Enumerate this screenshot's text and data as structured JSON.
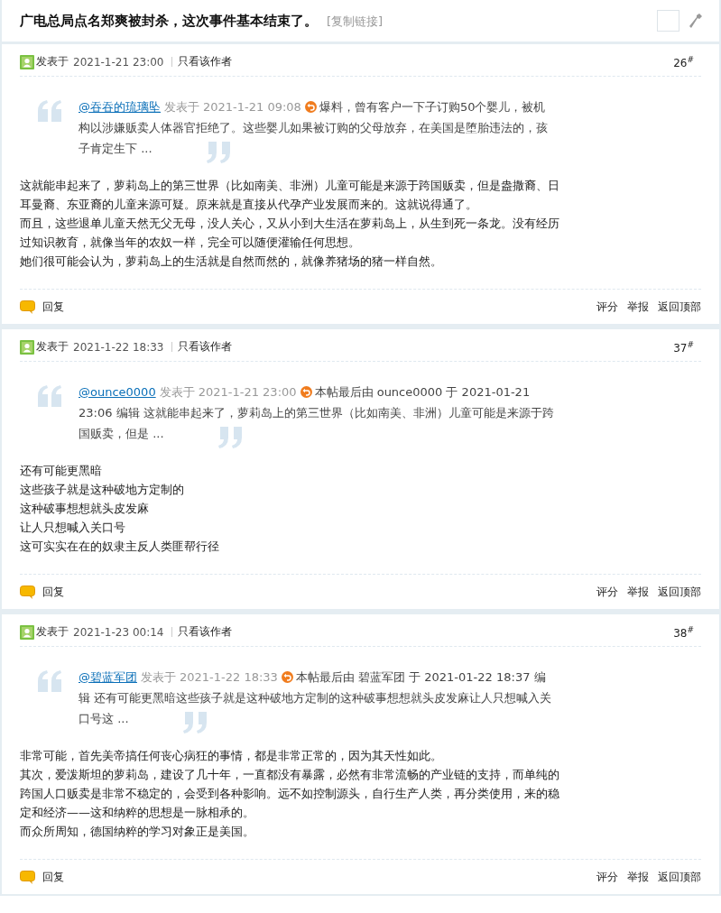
{
  "thread": {
    "title": "广电总局点名郑爽被封杀，这次事件基本结束了。",
    "copy_link": "[复制链接]"
  },
  "posts": [
    {
      "posted_label": "发表于",
      "date": "2021-1-21 23:00",
      "author_only": "只看该作者",
      "floor": "26$^{#}$",
      "quote": {
        "user": "@吞吞的琉璃坠",
        "posted_label": "发表于",
        "date": "2021-1-21 09:08",
        "text": "爆料，曾有客户一下子订购50个婴儿，被机构以涉嫌贩卖人体器官拒绝了。这些婴儿如果被订购的父母放弃，在美国是堕胎违法的，孩子肯定生下 ..."
      },
      "body": [
        "这就能串起来了，萝莉岛上的第三世界（比如南美、非洲）儿童可能是来源于跨国贩卖，但是盎撒裔、日耳曼裔、东亚裔的儿童来源可疑。原来就是直接从代孕产业发展而来的。这就说得通了。",
        "而且，这些退单儿童天然无父无母，没人关心，又从小到大生活在萝莉岛上，从生到死一条龙。没有经历过知识教育，就像当年的农奴一样，完全可以随便灌输任何思想。",
        "她们很可能会认为，萝莉岛上的生活就是自然而然的，就像养猪场的猪一样自然。"
      ],
      "reply": "回复",
      "actions": [
        "评分",
        "举报",
        "返回顶部"
      ]
    },
    {
      "posted_label": "发表于",
      "date": "2021-1-22 18:33",
      "author_only": "只看该作者",
      "floor": "37$^{#}$",
      "quote": {
        "user": "@ounce0000",
        "posted_label": "发表于",
        "date": "2021-1-21 23:00",
        "text": "本帖最后由 ounce0000 于 2021-01-21 23:06 编辑 这就能串起来了，萝莉岛上的第三世界（比如南美、非洲）儿童可能是来源于跨国贩卖，但是 ..."
      },
      "body": [
        "还有可能更黑暗",
        "这些孩子就是这种破地方定制的",
        "这种破事想想就头皮发麻",
        "让人只想喊入关口号",
        "这可实实在在的奴隶主反人类匪帮行径"
      ],
      "reply": "回复",
      "actions": [
        "评分",
        "举报",
        "返回顶部"
      ]
    },
    {
      "posted_label": "发表于",
      "date": "2021-1-23 00:14",
      "author_only": "只看该作者",
      "floor": "38$^{#}$",
      "quote": {
        "user": "@碧蓝军团",
        "posted_label": "发表于",
        "date": "2021-1-22 18:33",
        "text": "本帖最后由 碧蓝军团 于 2021-01-22 18:37 编辑 还有可能更黑暗这些孩子就是这种破地方定制的这种破事想想就头皮发麻让人只想喊入关口号这 ..."
      },
      "body": [
        "非常可能，首先美帝搞任何丧心病狂的事情，都是非常正常的，因为其天性如此。",
        "其次，爱泼斯坦的萝莉岛，建设了几十年，一直都没有暴露，必然有非常流畅的产业链的支持，而单纯的跨国人口贩卖是非常不稳定的，会受到各种影响。远不如控制源头，自行生产人类，再分类使用，来的稳定和经济——这和纳粹的思想是一脉相承的。",
        "而众所周知，德国纳粹的学习对象正是美国。"
      ],
      "reply": "回复",
      "actions": [
        "评分",
        "举报",
        "返回顶部"
      ]
    }
  ]
}
